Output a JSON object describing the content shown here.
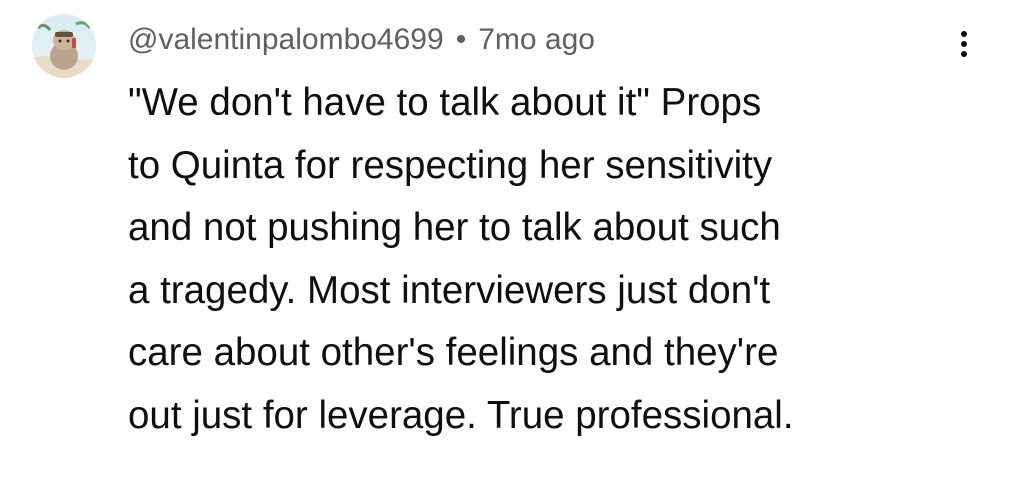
{
  "comment": {
    "author_handle": "@valentinpalombo4699",
    "separator": "•",
    "timestamp": "7mo ago",
    "avatar_icon": "avatar-image",
    "more_icon": "more-vertical-icon",
    "text": "\"We don't have to talk about it\" Props\nto Quinta for respecting her sensitivity\nand not pushing her to talk about such\na tragedy. Most interviewers just don't\ncare about other's feelings and they're\nout just for leverage. True professional."
  },
  "colors": {
    "text_primary": "#0f0f0f",
    "text_secondary": "#606060",
    "background": "#ffffff"
  }
}
